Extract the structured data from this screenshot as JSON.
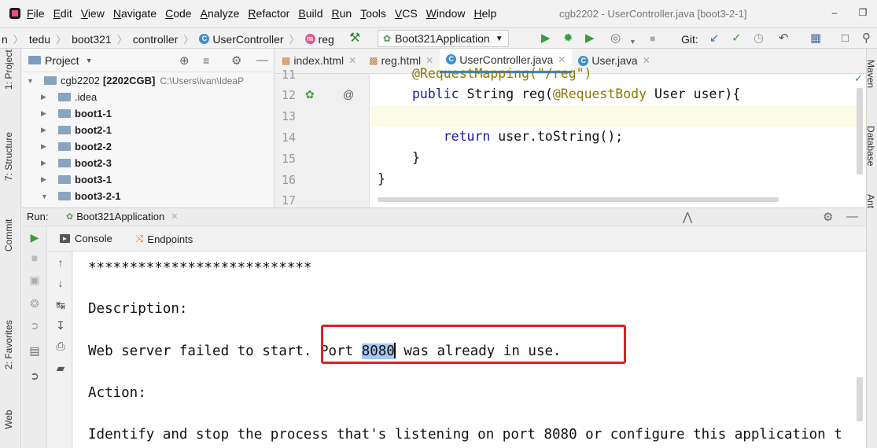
{
  "menu": {
    "items": [
      "File",
      "Edit",
      "View",
      "Navigate",
      "Code",
      "Analyze",
      "Refactor",
      "Build",
      "Run",
      "Tools",
      "VCS",
      "Window",
      "Help"
    ],
    "window_title": "cgb2202 - UserController.java [boot3-2-1]"
  },
  "navbar": {
    "crumbs": [
      "n",
      "tedu",
      "boot321",
      "controller",
      "UserController",
      "reg"
    ],
    "run_config": "Boot321Application",
    "git_label": "Git:"
  },
  "left_strip": {
    "project": "1: Project",
    "structure": "7: Structure",
    "commit": "Commit",
    "favorites": "2: Favorites",
    "web": "Web"
  },
  "right_strip": {
    "maven": "Maven",
    "database": "Database",
    "ant": "Ant"
  },
  "project": {
    "header": "Project",
    "tree": [
      {
        "name": "cgb2202",
        "tag": "[2202CGB]",
        "path": "C:\\Users\\ivan\\IdeaP",
        "bold": false,
        "open": true,
        "indent": 0
      },
      {
        "name": ".idea",
        "bold": false,
        "open": false,
        "indent": 1
      },
      {
        "name": "boot1-1",
        "bold": true,
        "open": false,
        "indent": 1
      },
      {
        "name": "boot2-1",
        "bold": true,
        "open": false,
        "indent": 1
      },
      {
        "name": "boot2-2",
        "bold": true,
        "open": false,
        "indent": 1
      },
      {
        "name": "boot2-3",
        "bold": true,
        "open": false,
        "indent": 1
      },
      {
        "name": "boot3-1",
        "bold": true,
        "open": false,
        "indent": 1
      },
      {
        "name": "boot3-2-1",
        "bold": true,
        "open": true,
        "indent": 1
      }
    ]
  },
  "editor": {
    "tabs": [
      {
        "label": "index.html",
        "active": false
      },
      {
        "label": "reg.html",
        "active": false
      },
      {
        "label": "UserController.java",
        "active": true
      },
      {
        "label": "User.java",
        "active": false
      }
    ],
    "lines": [
      {
        "num": "11",
        "code": "@RequestMapping(\"/reg\")"
      },
      {
        "num": "12",
        "code": "public String reg(@RequestBody User user){"
      },
      {
        "num": "13",
        "code": ""
      },
      {
        "num": "14",
        "code": "    return user.toString();"
      },
      {
        "num": "15",
        "code": "}"
      },
      {
        "num": "16",
        "code": "}"
      },
      {
        "num": "17",
        "code": ""
      }
    ]
  },
  "run": {
    "label": "Run:",
    "config_tab": "Boot321Application",
    "console_tab": "Console",
    "endpoints_tab": "Endpoints"
  },
  "console": {
    "stars": "***************************",
    "description": "Description:",
    "error_prefix": "Web server failed to start. Port ",
    "port": "8080",
    "error_suffix": " was already in use.",
    "action": "Action:",
    "action_text": "Identify and stop the process that's listening on port 8080 or configure this application t"
  },
  "colors": {
    "accent": "#4083c9",
    "highlight_box": "#e02020",
    "selection": "#a6c8ef"
  }
}
